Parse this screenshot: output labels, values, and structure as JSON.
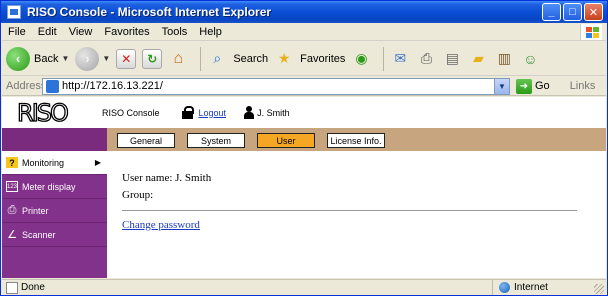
{
  "window": {
    "title": "RISO Console - Microsoft Internet Explorer",
    "controls": [
      "_",
      "□",
      "✕"
    ]
  },
  "menubar": {
    "items": [
      "File",
      "Edit",
      "View",
      "Favorites",
      "Tools",
      "Help"
    ]
  },
  "toolbar": {
    "back_label": "Back",
    "search_label": "Search",
    "favorites_label": "Favorites"
  },
  "address": {
    "label": "Address",
    "url": "http://172.16.13.221/",
    "go_label": "Go",
    "links_label": "Links"
  },
  "riso": {
    "logo": "RISO",
    "console_label": "RISO Console",
    "logout_label": "Logout",
    "user_name": "J. Smith"
  },
  "tabs": [
    {
      "label": "General",
      "active": false
    },
    {
      "label": "System",
      "active": false
    },
    {
      "label": "User",
      "active": true
    },
    {
      "label": "License Info.",
      "active": false
    }
  ],
  "sidebar": {
    "items": [
      {
        "label": "Monitoring",
        "icon": "monitoring-icon",
        "glyph": "?",
        "active": true
      },
      {
        "label": "Meter display",
        "icon": "meter-icon",
        "glyph": "123",
        "active": false
      },
      {
        "label": "Printer",
        "icon": "printer-icon",
        "glyph": "⎙",
        "active": false
      },
      {
        "label": "Scanner",
        "icon": "scanner-icon",
        "glyph": "∠",
        "active": false
      }
    ]
  },
  "main": {
    "user_name_line": "User name: J. Smith",
    "group_line": "Group:",
    "change_password_label": "Change password"
  },
  "status": {
    "text": "Done",
    "zone": "Internet"
  },
  "colors": {
    "sidebar_purple": "#82328a",
    "tab_bar_tan": "#c7a57e",
    "active_tab": "#f5a623",
    "link_blue": "#1c3abf"
  }
}
